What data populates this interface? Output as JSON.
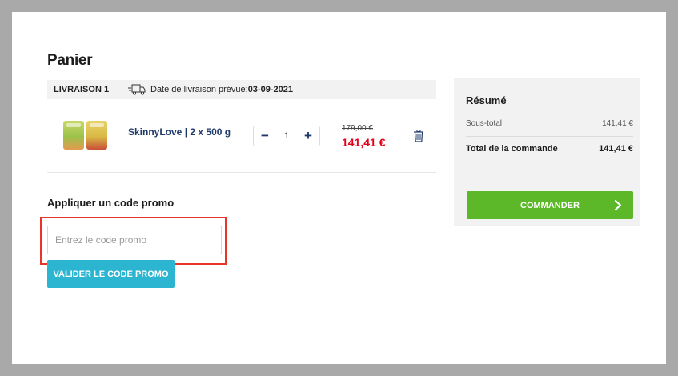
{
  "cart": {
    "title": "Panier",
    "delivery": {
      "label": "LIVRAISON 1",
      "text": "Date de livraison prévue: ",
      "date": "03-09-2021"
    },
    "item": {
      "name": "SkinnyLove | 2 x 500 g",
      "quantity": "1",
      "decrement_label": "−",
      "increment_label": "+",
      "old_price": "179,00 €",
      "new_price": "141,41 €"
    }
  },
  "promo": {
    "title": "Appliquer un code promo",
    "placeholder": "Entrez le code promo",
    "button_label": "VALIDER LE CODE PROMO"
  },
  "summary": {
    "title": "Résumé",
    "subtotal_label": "Sous-total",
    "subtotal_value": "141,41 €",
    "total_label": "Total de la commande",
    "total_value": "141,41 €",
    "order_button_label": "COMMANDER"
  },
  "colors": {
    "accent_green": "#5cb828",
    "accent_blue": "#2cb5d1",
    "price_red": "#e2001a",
    "highlight_red": "#e8352a"
  },
  "icons": {
    "delivery": "truck-icon",
    "remove": "trash-icon",
    "order": "chevron-right-icon"
  }
}
